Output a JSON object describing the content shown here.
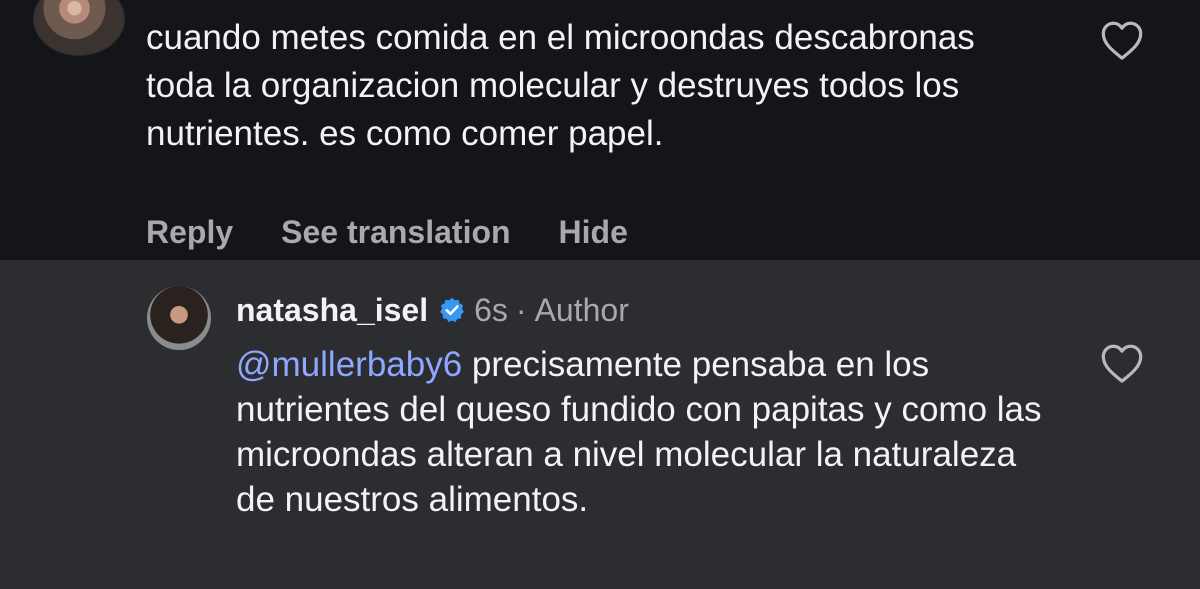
{
  "parent_comment": {
    "text": "cuando metes comida en el microondas descabronas toda la organizacion molecular y destruyes todos los nutrientes. es como comer papel.",
    "actions": [
      "Reply",
      "See translation",
      "Hide"
    ]
  },
  "reply": {
    "username": "natasha_isel",
    "time": "6s",
    "separator": "·",
    "author_label": "Author",
    "mention": "@mullerbaby6",
    "text": " precisamente pensaba en los nutrientes del queso fundido con papitas y como las microondas alteran a nivel molecular la naturaleza de nuestros alimentos."
  },
  "colors": {
    "background_dark": "#131518",
    "reply_background": "#2b2d31",
    "text": "#f2f3f5",
    "muted": "#a8a9ad",
    "mention": "#8fa8ff",
    "verified": "#3897f0"
  },
  "icons": {
    "like": "heart-outline-icon",
    "verified": "verified-badge-icon"
  }
}
